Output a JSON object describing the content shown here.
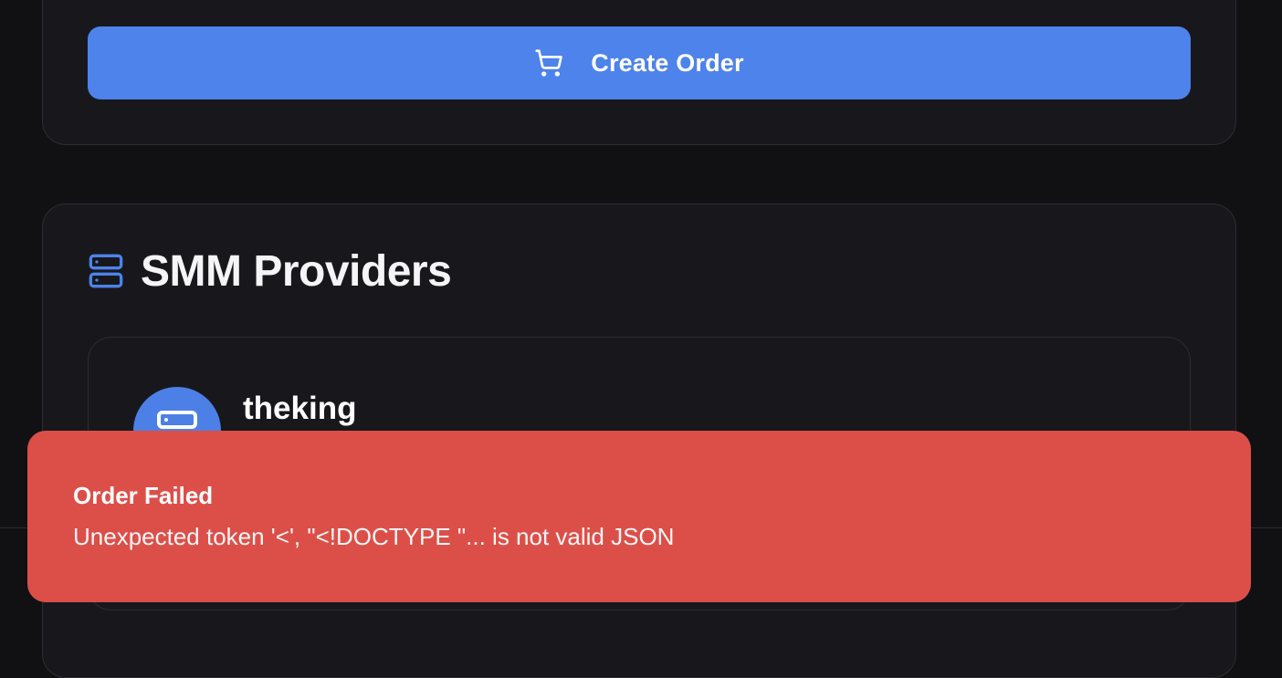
{
  "order_form": {
    "create_button": {
      "label": "Create Order",
      "icon": "shopping-cart-icon"
    }
  },
  "providers_section": {
    "icon": "server-icon",
    "title": "SMM Providers",
    "providers": [
      {
        "name": "theking",
        "icon": "server-icon"
      }
    ]
  },
  "toast": {
    "title": "Order Failed",
    "message": "Unexpected token '<', \"<!DOCTYPE \"... is not valid JSON",
    "color": "#dc4f49"
  },
  "colors": {
    "accent": "#4d83ea",
    "background": "#111114",
    "card": "#18181c",
    "error": "#dc4f49"
  }
}
